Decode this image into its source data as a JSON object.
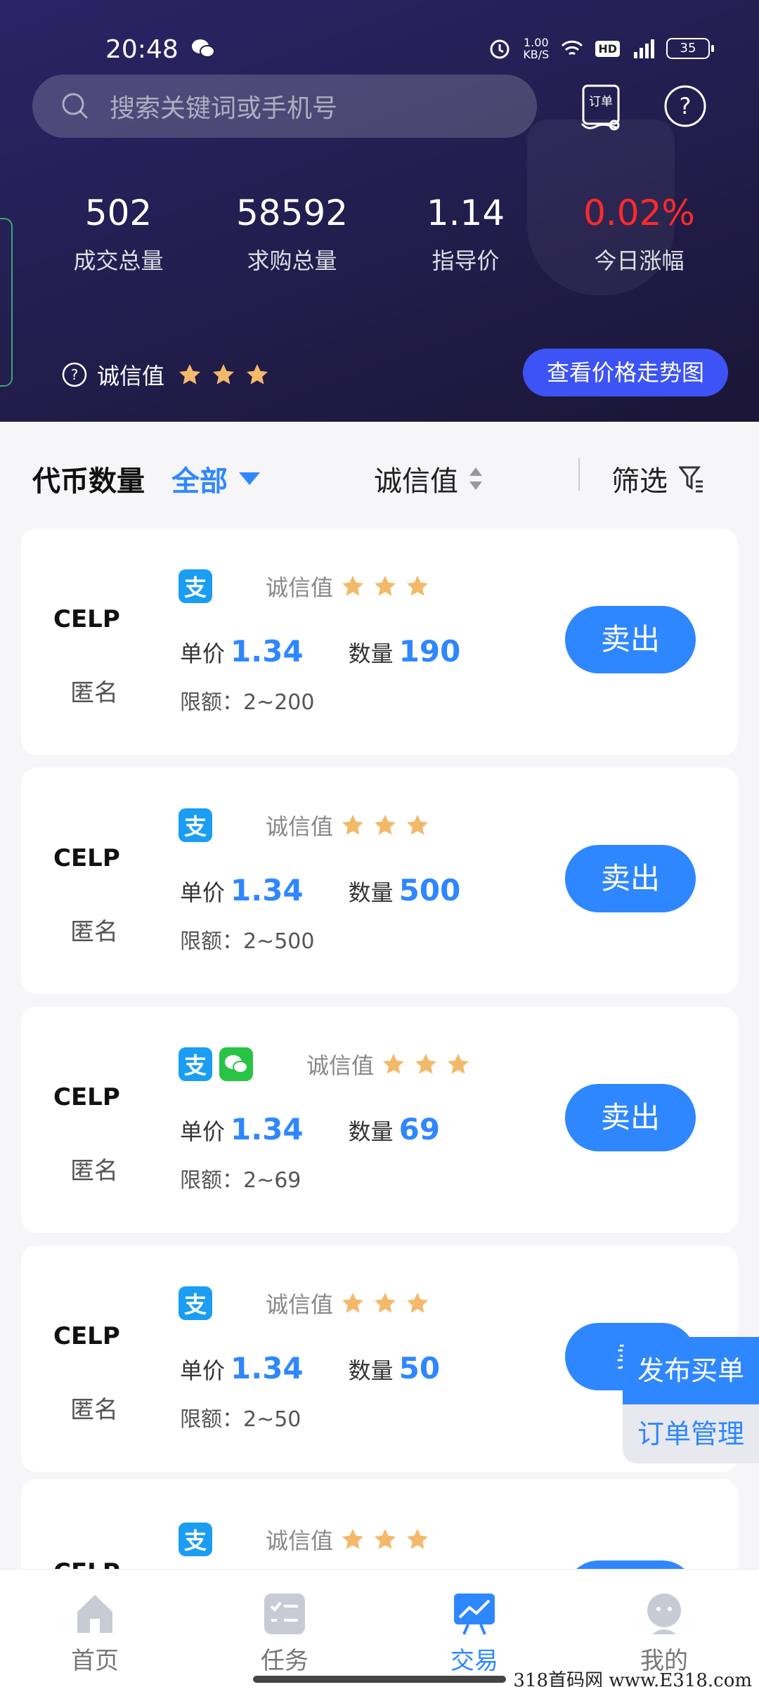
{
  "status_bar": {
    "time": "20:48",
    "net_speed": "1.00",
    "net_unit": "KB/S",
    "hd": "HD",
    "battery": "35"
  },
  "search": {
    "placeholder": "搜索关键词或手机号"
  },
  "header": {
    "order_icon_label": "订单"
  },
  "stats": [
    {
      "value": "502",
      "label": "成交总量"
    },
    {
      "value": "58592",
      "label": "求购总量"
    },
    {
      "value": "1.14",
      "label": "指导价"
    },
    {
      "value": "0.02%",
      "label": "今日涨幅"
    }
  ],
  "credit": {
    "label": "诚信值",
    "stars": 3
  },
  "trend_button": "查看价格走势图",
  "filter": {
    "title": "代币数量",
    "all": "全部",
    "credit_sort": "诚信值",
    "screen": "筛选"
  },
  "listings": [
    {
      "logo": "CELP",
      "seller": "匿名",
      "pay_methods": [
        "alipay"
      ],
      "credit_label": "诚信值",
      "stars": 3,
      "price_label": "单价",
      "price": "1.34",
      "qty_label": "数量",
      "qty": "190",
      "limit": "限额：2~200",
      "action": "卖出"
    },
    {
      "logo": "CELP",
      "seller": "匿名",
      "pay_methods": [
        "alipay"
      ],
      "credit_label": "诚信值",
      "stars": 3,
      "price_label": "单价",
      "price": "1.34",
      "qty_label": "数量",
      "qty": "500",
      "limit": "限额：2~500",
      "action": "卖出"
    },
    {
      "logo": "CELP",
      "seller": "匿名",
      "pay_methods": [
        "alipay",
        "wechat"
      ],
      "credit_label": "诚信值",
      "stars": 3,
      "price_label": "单价",
      "price": "1.34",
      "qty_label": "数量",
      "qty": "69",
      "limit": "限额：2~69",
      "action": "卖出"
    },
    {
      "logo": "CELP",
      "seller": "匿名",
      "pay_methods": [
        "alipay"
      ],
      "credit_label": "诚信值",
      "stars": 3,
      "price_label": "单价",
      "price": "1.34",
      "qty_label": "数量",
      "qty": "50",
      "limit": "限额：2~50",
      "action": "卖"
    }
  ],
  "partial_listing": {
    "credit_label": "诚信值",
    "logo": "CELP"
  },
  "float_actions": {
    "publish": "发布买单",
    "manage": "订单管理"
  },
  "pay_badge_alipay": "支",
  "nav": [
    {
      "label": "首页",
      "icon": "home-icon",
      "active": false
    },
    {
      "label": "任务",
      "icon": "task-icon",
      "active": false
    },
    {
      "label": "交易",
      "icon": "trade-chart-icon",
      "active": true
    },
    {
      "label": "我的",
      "icon": "profile-icon",
      "active": false
    }
  ],
  "watermark": "318首码网  www.E318.com",
  "colors": {
    "accent": "#2f87ff",
    "header_bg": "#231e50",
    "trend_button": "#3d53f5",
    "rise": "#ff2a2a",
    "star": "#f3b96a"
  }
}
